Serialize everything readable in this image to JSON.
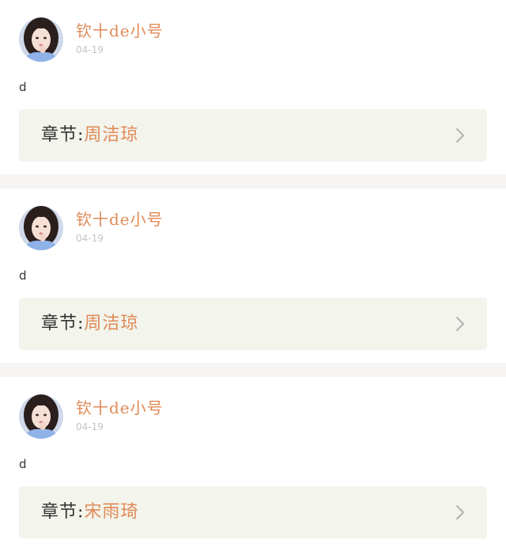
{
  "posts": [
    {
      "username": "钦十de小号",
      "date": "04-19",
      "content": "d",
      "chapter_label": "章节:",
      "chapter_name": "周洁琼"
    },
    {
      "username": "钦十de小号",
      "date": "04-19",
      "content": "d",
      "chapter_label": "章节:",
      "chapter_name": "周洁琼"
    },
    {
      "username": "钦十de小号",
      "date": "04-19",
      "content": "d",
      "chapter_label": "章节:",
      "chapter_name": "宋雨琦"
    }
  ],
  "icons": {
    "avatar": "avatar-photo",
    "chapter_arrow": "chevron-right-icon"
  },
  "colors": {
    "accent": "#e08a57",
    "chapter_bg": "#f3f4ec",
    "divider": "#f7f4f4",
    "date_text": "#c4c4c4"
  }
}
